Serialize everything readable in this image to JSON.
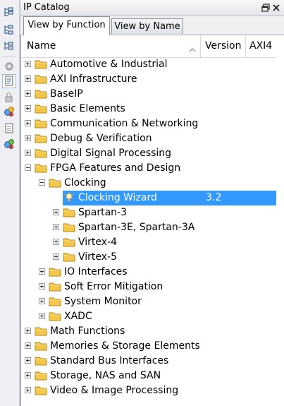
{
  "window": {
    "title": "IP Catalog"
  },
  "tabs": [
    {
      "label": "View by Function",
      "active": true
    },
    {
      "label": "View by Name",
      "active": false
    }
  ],
  "columns": {
    "name": "Name",
    "version": "Version",
    "axi": "AXI4"
  },
  "toolbar_icons": [
    "expand-all-icon",
    "collapse-all-icon",
    "hierarchy-icon",
    "customize-ip-icon",
    "datasheet-icon",
    "lock-icon",
    "generate-icon",
    "document-icon",
    "regenerate-icon"
  ],
  "colors": {
    "selection": "#3399ff",
    "folder": "#f3c64c"
  },
  "tree": [
    {
      "label": "Automotive & Industrial",
      "depth": 0,
      "state": "collapsed",
      "kind": "folder"
    },
    {
      "label": "AXI Infrastructure",
      "depth": 0,
      "state": "collapsed",
      "kind": "folder"
    },
    {
      "label": "BaseIP",
      "depth": 0,
      "state": "collapsed",
      "kind": "folder"
    },
    {
      "label": "Basic Elements",
      "depth": 0,
      "state": "collapsed",
      "kind": "folder"
    },
    {
      "label": "Communication & Networking",
      "depth": 0,
      "state": "collapsed",
      "kind": "folder"
    },
    {
      "label": "Debug & Verification",
      "depth": 0,
      "state": "collapsed",
      "kind": "folder"
    },
    {
      "label": "Digital Signal Processing",
      "depth": 0,
      "state": "collapsed",
      "kind": "folder"
    },
    {
      "label": "FPGA Features and Design",
      "depth": 0,
      "state": "expanded",
      "kind": "folder"
    },
    {
      "label": "Clocking",
      "depth": 1,
      "state": "expanded",
      "kind": "folder"
    },
    {
      "label": "Clocking Wizard",
      "depth": 2,
      "state": "leaf",
      "kind": "ip",
      "version": "3.2",
      "selected": true
    },
    {
      "label": "Spartan-3",
      "depth": 2,
      "state": "collapsed",
      "kind": "folder"
    },
    {
      "label": "Spartan-3E, Spartan-3A",
      "depth": 2,
      "state": "collapsed",
      "kind": "folder"
    },
    {
      "label": "Virtex-4",
      "depth": 2,
      "state": "collapsed",
      "kind": "folder"
    },
    {
      "label": "Virtex-5",
      "depth": 2,
      "state": "collapsed",
      "kind": "folder"
    },
    {
      "label": "IO Interfaces",
      "depth": 1,
      "state": "collapsed",
      "kind": "folder"
    },
    {
      "label": "Soft Error Mitigation",
      "depth": 1,
      "state": "collapsed",
      "kind": "folder"
    },
    {
      "label": "System Monitor",
      "depth": 1,
      "state": "collapsed",
      "kind": "folder"
    },
    {
      "label": "XADC",
      "depth": 1,
      "state": "collapsed",
      "kind": "folder"
    },
    {
      "label": "Math Functions",
      "depth": 0,
      "state": "collapsed",
      "kind": "folder"
    },
    {
      "label": "Memories & Storage Elements",
      "depth": 0,
      "state": "collapsed",
      "kind": "folder"
    },
    {
      "label": "Standard Bus Interfaces",
      "depth": 0,
      "state": "collapsed",
      "kind": "folder"
    },
    {
      "label": "Storage, NAS and SAN",
      "depth": 0,
      "state": "collapsed",
      "kind": "folder"
    },
    {
      "label": "Video & Image Processing",
      "depth": 0,
      "state": "collapsed",
      "kind": "folder"
    }
  ]
}
